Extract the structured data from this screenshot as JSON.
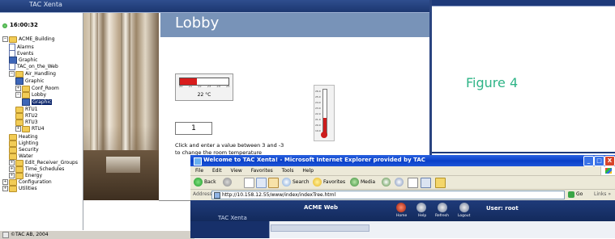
{
  "back_window": {
    "header_label": "TAC Xenta",
    "clock": "16:00:32",
    "lobby_title": "Lobby",
    "temperature": {
      "reading": "22 °C",
      "scale_ticks": [
        "20",
        "21",
        "22",
        "23",
        "24",
        "25"
      ],
      "fill_fraction": 0.35
    },
    "thermometer": {
      "tick_labels": [
        "26.0",
        "25.0",
        "24.0",
        "23.0",
        "22.0",
        "21.0",
        "20.0",
        "19.0"
      ],
      "fill_fraction": 0.38
    },
    "setpoint_input_value": "1",
    "hint_line1": "Click and enter a value between 3 and -3",
    "hint_line2": "to change the room temperature",
    "status_text": "©TAC AB, 2004"
  },
  "tree": [
    {
      "label": "ACME_Building",
      "icon": "folder-icon",
      "pm": "−"
    },
    {
      "label": "Alarms",
      "icon": "alarm-icon"
    },
    {
      "label": "Events",
      "icon": "events-icon"
    },
    {
      "label": "Graphic",
      "icon": "graphic-icon"
    },
    {
      "label": "TAC_on_the_Web",
      "icon": "page-icon"
    },
    {
      "label": "Air_Handling",
      "icon": "folder-icon",
      "pm": "−"
    },
    {
      "label": "Graphic",
      "icon": "graphic-icon"
    },
    {
      "label": "Conf_Room",
      "icon": "folder-icon",
      "pm": "+"
    },
    {
      "label": "Lobby",
      "icon": "folder-icon",
      "pm": "−"
    },
    {
      "label": "Graphic",
      "icon": "graphic-icon",
      "selected": true
    },
    {
      "label": "RTU1",
      "icon": "folder-icon"
    },
    {
      "label": "RTU2",
      "icon": "folder-icon"
    },
    {
      "label": "RTU3",
      "icon": "folder-icon"
    },
    {
      "label": "RTU4",
      "icon": "folder-icon",
      "pm": "+"
    },
    {
      "label": "Heating",
      "icon": "folder-icon"
    },
    {
      "label": "Lighting",
      "icon": "folder-icon"
    },
    {
      "label": "Security",
      "icon": "folder-icon"
    },
    {
      "label": "Water",
      "icon": "folder-icon"
    },
    {
      "label": "Edit_Receiver_Groups",
      "icon": "folder-icon",
      "pm": "+"
    },
    {
      "label": "Time_Schedules",
      "icon": "folder-icon",
      "pm": "+"
    },
    {
      "label": "Energy",
      "icon": "folder-icon",
      "pm": "+"
    },
    {
      "label": "Configuration",
      "icon": "folder-icon",
      "pm": "+"
    },
    {
      "label": "Utilities",
      "icon": "folder-icon",
      "pm": "+"
    }
  ],
  "figure_label": "Figure 4",
  "ie_window": {
    "title": "Welcome to TAC Xenta! - Microsoft Internet Explorer provided by TAC",
    "window_buttons": [
      "_",
      "□",
      "X"
    ],
    "menu": [
      "File",
      "Edit",
      "View",
      "Favorites",
      "Tools",
      "Help"
    ],
    "toolbar": {
      "back": "Back",
      "search": "Search",
      "favorites": "Favorites",
      "media": "Media"
    },
    "address_label": "Address",
    "address_value": "http://10.158.12.55/www/index/indexTree.html",
    "go_label": "Go",
    "links_label": "Links »",
    "acme_title": "ACME Web",
    "tac_label": "TAC Xenta",
    "nav": [
      "Home",
      "Help",
      "Refresh",
      "Logout"
    ],
    "user_label": "User: root"
  },
  "colors": {
    "figure_label": "#2fb487",
    "header_blue": "#1f3b7a",
    "lobby_band": "#7893b8"
  }
}
